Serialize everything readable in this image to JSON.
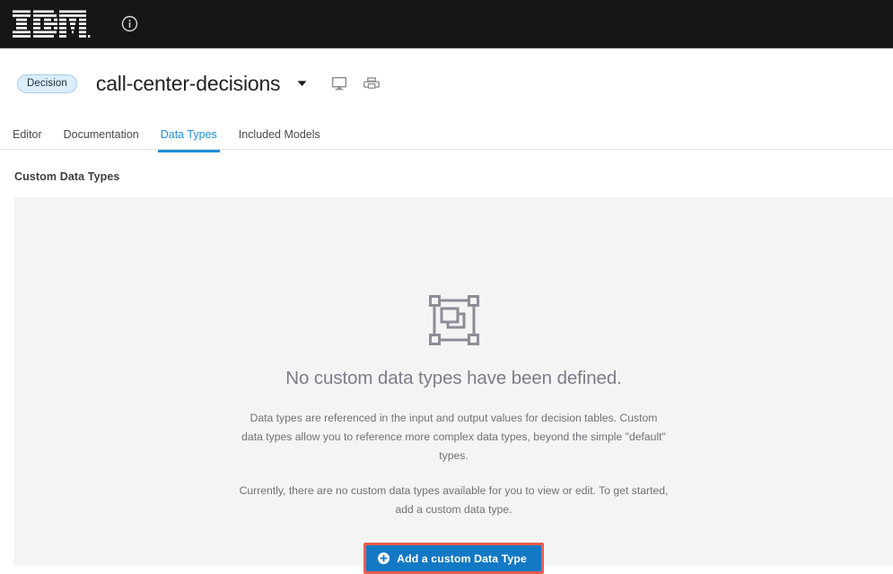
{
  "topbar": {
    "brand": "IBM",
    "brand_logo_icon": "ibm-logo",
    "info_icon": "info-circle-icon",
    "background_color": "#161616"
  },
  "title_row": {
    "tag_label": "Decision",
    "tag_background_color": "#dbeeff",
    "tag_border_color": "#a6c8e8",
    "document_title": "call-center-decisions",
    "caret_icon": "chevron-down-icon",
    "actions": [
      {
        "icon": "monitor-icon",
        "name": "preview-monitor-button"
      },
      {
        "icon": "printer-icon",
        "name": "print-button"
      }
    ]
  },
  "tabs": {
    "items": [
      {
        "label": "Editor",
        "active": false
      },
      {
        "label": "Documentation",
        "active": false
      },
      {
        "label": "Data Types",
        "active": true
      },
      {
        "label": "Included Models",
        "active": false
      }
    ],
    "active_color": "#1f8ed6"
  },
  "section": {
    "heading": "Custom Data Types"
  },
  "panel": {
    "background_color": "#f4f4f4",
    "empty_state": {
      "icon": "select-objects-icon",
      "title": "No custom data types have been defined.",
      "paragraph_1": "Data types are referenced in the input and output values for decision tables. Custom data types allow you to reference more complex data types, beyond the simple \"default\" types.",
      "paragraph_2": "Currently, there are no custom data types available for you to view or edit. To get started, add a custom data type.",
      "cta": {
        "label": "Add a custom Data Type",
        "icon": "plus-circle-icon",
        "background_color": "#1479c4",
        "text_color": "#ffffff",
        "highlight_border_color": "#ef5b4f"
      }
    }
  }
}
